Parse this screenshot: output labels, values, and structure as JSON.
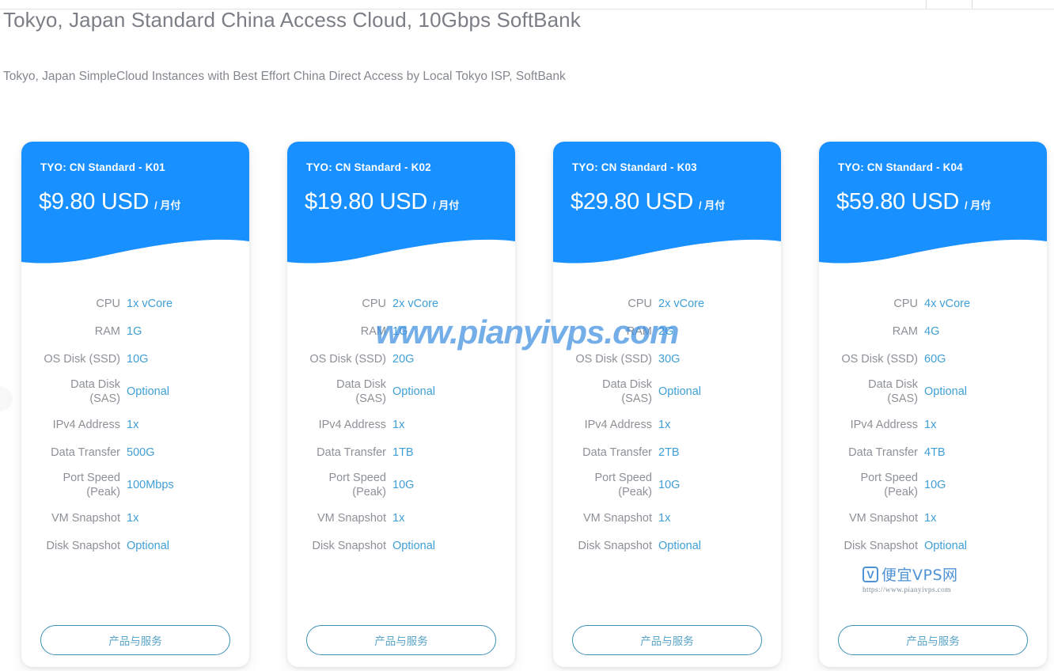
{
  "page": {
    "title": "Tokyo, Japan Standard China Access Cloud, 10Gbps SoftBank",
    "subtitle": "Tokyo, Japan SimpleCloud Instances with Best Effort China Direct Access by Local Tokyo ISP, SoftBank"
  },
  "theme": {
    "header_blue": "#1890ff",
    "value_blue": "#3f9fd6",
    "label_gray": "#8d9196",
    "title_gray": "#7b7f85",
    "button_border": "#3f8fb5",
    "watermark_blue": "#3f8fe0"
  },
  "watermark": {
    "text": "www.pianyivps.com",
    "logo_badge": "V",
    "logo_name": "便宜VPS网",
    "logo_url": "https://www.pianyivps.com"
  },
  "spec_labels": [
    "CPU",
    "RAM",
    "OS Disk (SSD)",
    "Data Disk (SAS)",
    "IPv4 Address",
    "Data Transfer",
    "Port Speed (Peak)",
    "VM Snapshot",
    "Disk Snapshot"
  ],
  "cta_label": "产品与服务",
  "cards": [
    {
      "plan": "TYO: CN Standard - K01",
      "price": "$9.80 USD",
      "cycle": "/ 月付",
      "specs": {
        "cpu": "1x vCore",
        "ram": "1G",
        "os_disk": "10G",
        "data_disk": "Optional",
        "ipv4": "1x",
        "transfer": "500G",
        "port_speed": "100Mbps",
        "vm_snapshot": "1x",
        "disk_snapshot": "Optional"
      }
    },
    {
      "plan": "TYO: CN Standard - K02",
      "price": "$19.80 USD",
      "cycle": "/ 月付",
      "specs": {
        "cpu": "2x vCore",
        "ram": "1G",
        "os_disk": "20G",
        "data_disk": "Optional",
        "ipv4": "1x",
        "transfer": "1TB",
        "port_speed": "10G",
        "vm_snapshot": "1x",
        "disk_snapshot": "Optional"
      }
    },
    {
      "plan": "TYO: CN Standard - K03",
      "price": "$29.80 USD",
      "cycle": "/ 月付",
      "specs": {
        "cpu": "2x vCore",
        "ram": "2G",
        "os_disk": "30G",
        "data_disk": "Optional",
        "ipv4": "1x",
        "transfer": "2TB",
        "port_speed": "10G",
        "vm_snapshot": "1x",
        "disk_snapshot": "Optional"
      }
    },
    {
      "plan": "TYO: CN Standard - K04",
      "price": "$59.80 USD",
      "cycle": "/ 月付",
      "specs": {
        "cpu": "4x vCore",
        "ram": "4G",
        "os_disk": "60G",
        "data_disk": "Optional",
        "ipv4": "1x",
        "transfer": "4TB",
        "port_speed": "10G",
        "vm_snapshot": "1x",
        "disk_snapshot": "Optional"
      }
    }
  ]
}
